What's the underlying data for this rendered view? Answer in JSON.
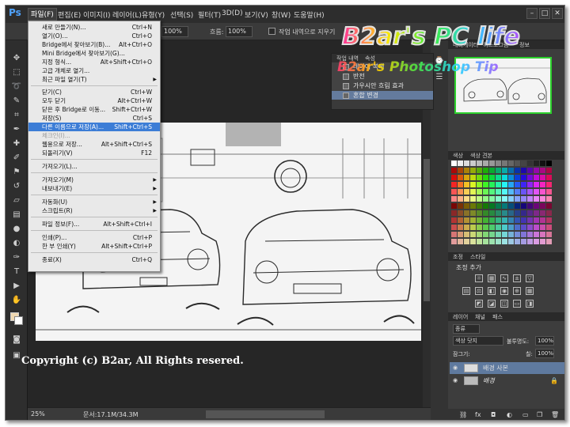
{
  "app": {
    "logo": "Ps"
  },
  "menubar": {
    "items": [
      {
        "label": "파일(F)"
      },
      {
        "label": "편집(E)"
      },
      {
        "label": "이미지(I)"
      },
      {
        "label": "레이어(L)"
      },
      {
        "label": "유형(Y)"
      },
      {
        "label": "선택(S)"
      },
      {
        "label": "필터(T)"
      },
      {
        "label": "3D(D)"
      },
      {
        "label": "보기(V)"
      },
      {
        "label": "창(W)"
      },
      {
        "label": "도움말(H)"
      }
    ]
  },
  "options_bar": {
    "zoom": "100%",
    "flow_label": "흐름:",
    "flow_value": "100%",
    "history_checkbox_label": "작업 내역으로 지우기"
  },
  "file_menu": {
    "items": [
      {
        "label": "새로 만들기(N)...",
        "shortcut": "Ctrl+N"
      },
      {
        "label": "열기(O)...",
        "shortcut": "Ctrl+O"
      },
      {
        "label": "Bridge에서 찾아보기(B)...",
        "shortcut": "Alt+Ctrl+O"
      },
      {
        "label": "Mini Bridge에서 찾아보기(G)...",
        "shortcut": ""
      },
      {
        "label": "지정 형식...",
        "shortcut": "Alt+Shift+Ctrl+O"
      },
      {
        "label": "고급 개체로 열기...",
        "shortcut": ""
      },
      {
        "label": "최근 파일 열기(T)",
        "shortcut": ""
      },
      {
        "label": "닫기(C)",
        "shortcut": "Ctrl+W"
      },
      {
        "label": "모두 닫기",
        "shortcut": "Alt+Ctrl+W"
      },
      {
        "label": "닫은 후 Bridge로 이동...",
        "shortcut": "Shift+Ctrl+W"
      },
      {
        "label": "저장(S)",
        "shortcut": "Ctrl+S"
      },
      {
        "label": "다른 이름으로 저장(A)...",
        "shortcut": "Shift+Ctrl+S"
      },
      {
        "label": "체크인(I)...",
        "shortcut": ""
      },
      {
        "label": "웹용으로 저장...",
        "shortcut": "Alt+Shift+Ctrl+S"
      },
      {
        "label": "되돌리기(V)",
        "shortcut": "F12"
      },
      {
        "label": "가져오기(L)...",
        "shortcut": ""
      },
      {
        "label": "가져오기(M)",
        "shortcut": ""
      },
      {
        "label": "내보내기(E)",
        "shortcut": ""
      },
      {
        "label": "자동화(U)",
        "shortcut": ""
      },
      {
        "label": "스크립트(R)",
        "shortcut": ""
      },
      {
        "label": "파일 정보(F)...",
        "shortcut": "Alt+Shift+Ctrl+I"
      },
      {
        "label": "인쇄(P)...",
        "shortcut": "Ctrl+P"
      },
      {
        "label": "한 부 인쇄(Y)",
        "shortcut": "Alt+Shift+Ctrl+P"
      },
      {
        "label": "종료(X)",
        "shortcut": "Ctrl+Q"
      }
    ]
  },
  "history_panel": {
    "tabs": [
      "작업 내역",
      "속성"
    ],
    "rows": [
      {
        "label": "레이어 복제"
      },
      {
        "label": "반전"
      },
      {
        "label": "가우시안 흐림 효과"
      },
      {
        "label": "혼합 변경"
      }
    ]
  },
  "panels": {
    "navigator_tabs": [
      "내비게이터",
      "히스토그램",
      "정보"
    ],
    "color_tabs": [
      "색상",
      "색상 견본"
    ],
    "adjust_tabs": [
      "조정",
      "스타일"
    ],
    "adjust_title": "조정 추가",
    "layers_tabs": [
      "레이어",
      "채널",
      "패스"
    ],
    "kind_label": "종류",
    "blend_mode": "색상 닷지",
    "opacity_label": "불투명도:",
    "opacity_value": "100%",
    "lock_label": "잠그기:",
    "fill_label": "칠:",
    "fill_value": "100%",
    "layers": [
      {
        "name": "배경 사본"
      },
      {
        "name": "배경"
      }
    ]
  },
  "status": {
    "zoom": "25%",
    "doc_size": "문서:17.1M/34.3M"
  },
  "copyright": "Copyright (c) B2ar, All Rights resered.",
  "watermark": {
    "line1": "B2ar's PC life",
    "line2": "B2ar's Photoshop Tip"
  }
}
